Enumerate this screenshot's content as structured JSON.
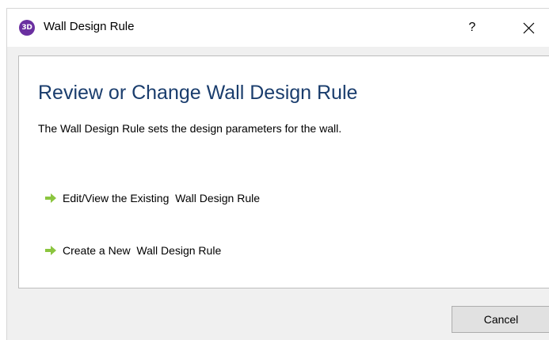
{
  "window": {
    "title": "Wall Design Rule",
    "app_icon_text": "3D",
    "help_label": "?"
  },
  "main": {
    "heading": "Review or Change Wall Design Rule",
    "description": "The Wall Design Rule sets the design parameters for the wall.",
    "options": [
      {
        "label": "Edit/View the Existing  Wall Design Rule",
        "icon": "green-arrow-icon"
      },
      {
        "label": "Create a New  Wall Design Rule",
        "icon": "green-arrow-icon"
      }
    ]
  },
  "footer": {
    "cancel_label": "Cancel"
  },
  "colors": {
    "heading": "#1a3d6d",
    "app_icon": "#6a2fa0",
    "arrow": "#8bc53f"
  }
}
